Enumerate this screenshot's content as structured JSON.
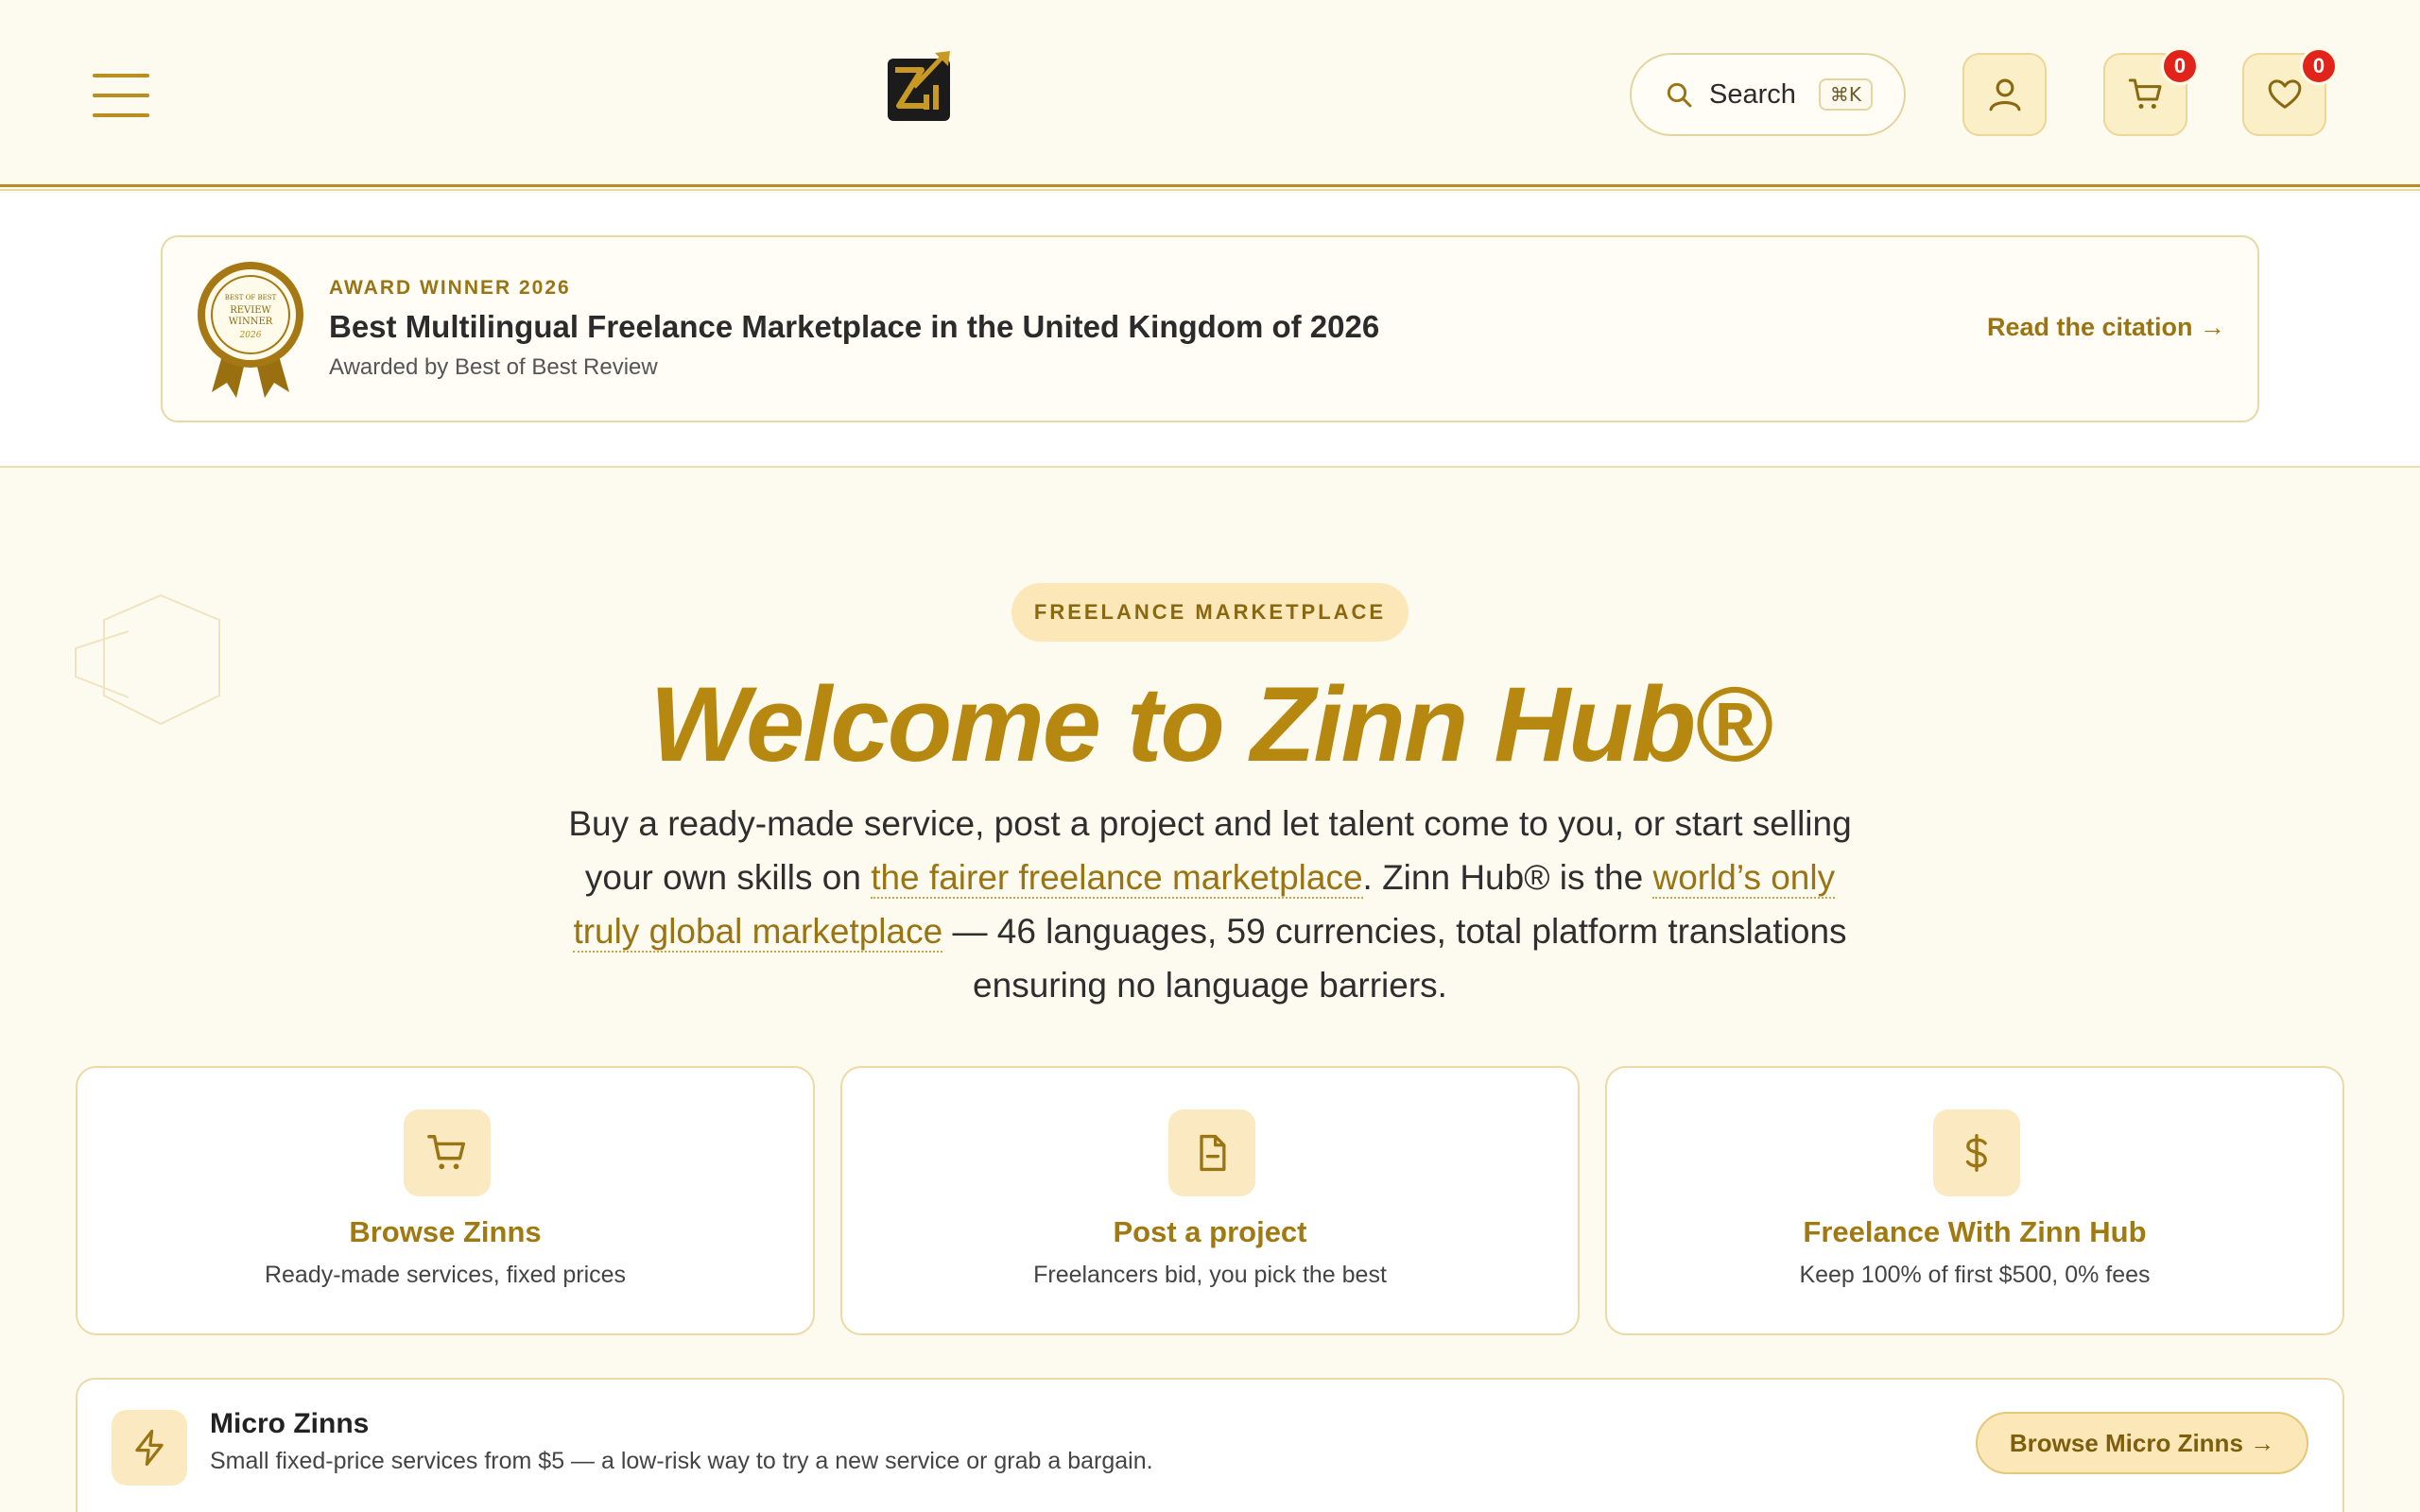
{
  "header": {
    "search": {
      "label": "Search",
      "shortcut": "⌘K"
    },
    "cart_count": "0",
    "wishlist_count": "0"
  },
  "award": {
    "seal_text": [
      "BEST OF BEST",
      "REVIEW",
      "WINNER",
      "2026"
    ],
    "kicker": "AWARD WINNER 2026",
    "title": "Best Multilingual Freelance Marketplace in the United Kingdom of 2026",
    "by": "Awarded by Best of Best Review",
    "link": "Read the citation →"
  },
  "hero": {
    "pill": "FREELANCE MARKETPLACE",
    "title": "Welcome to Zinn Hub®",
    "desc_1": "Buy a ready-made service, post a project and let talent come to you, or start selling your own skills on ",
    "desc_link_1": "the fairer freelance marketplace",
    "desc_2": ". Zinn Hub® is the ",
    "desc_link_2": "world’s only truly global marketplace",
    "desc_3": " — 46 languages, 59 currencies, total platform translations ensuring no language barriers."
  },
  "cards": [
    {
      "icon": "cart-icon",
      "title": "Browse Zinns",
      "subtitle": "Ready-made services, fixed prices"
    },
    {
      "icon": "document-icon",
      "title": "Post a project",
      "subtitle": "Freelancers bid, you pick the best"
    },
    {
      "icon": "dollar-icon",
      "title": "Freelance With Zinn Hub",
      "subtitle": "Keep 100% of first $500, 0% fees"
    }
  ],
  "micro": {
    "icon": "lightning-icon",
    "title": "Micro Zinns",
    "subtitle": "Small fixed-price services from $5 — a low-risk way to try a new service or grab a bargain.",
    "button": "Browse Micro Zinns →"
  },
  "colors": {
    "accent": "#b7880f",
    "accent_dark": "#9a7412",
    "soft_fill": "#fbeac1",
    "badge": "#e2231a",
    "background": "#fdfaf0"
  }
}
